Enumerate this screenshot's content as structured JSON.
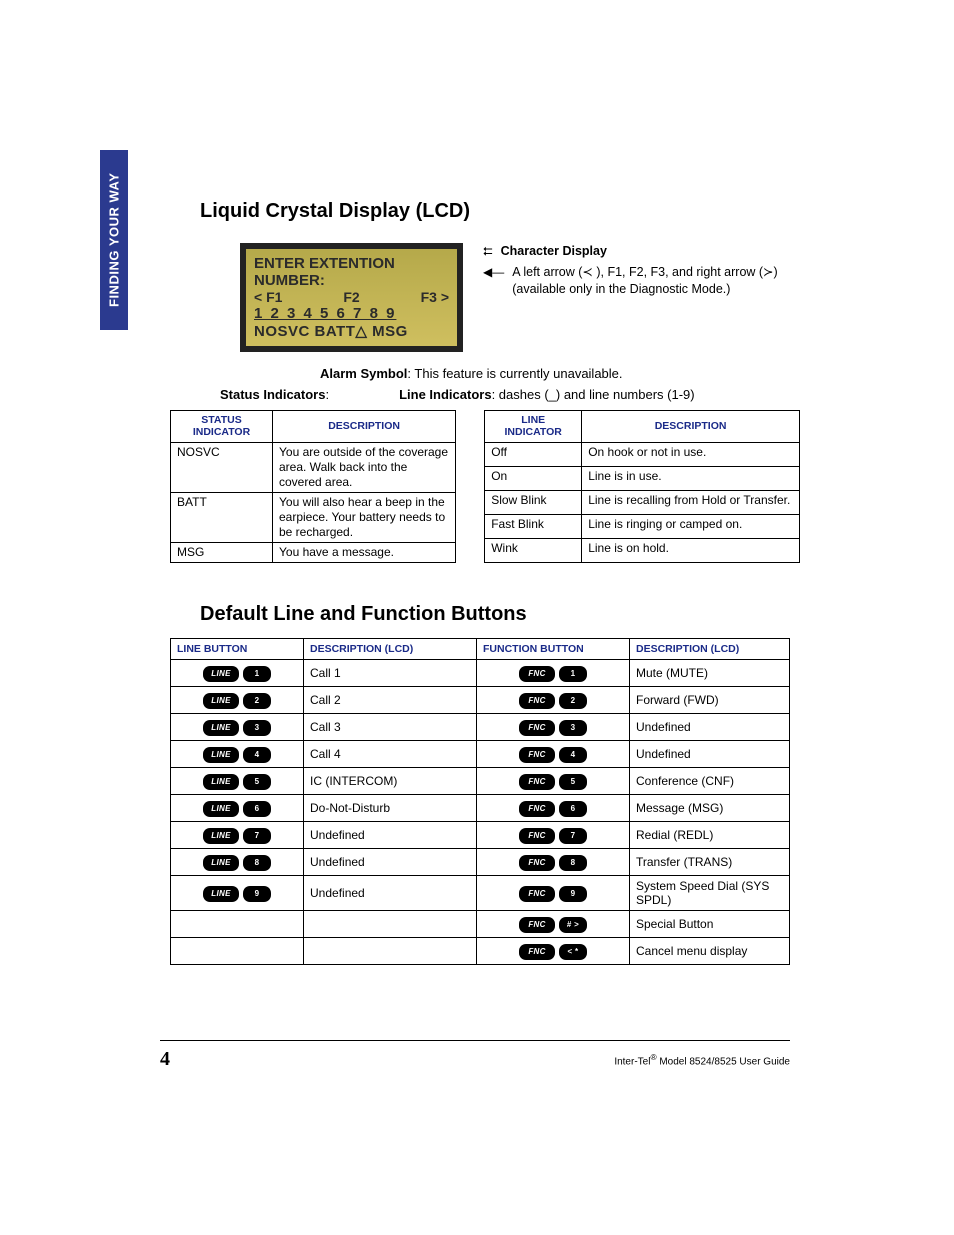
{
  "sideTab": "FINDING YOUR WAY",
  "heading1": "Liquid Crystal Display (LCD)",
  "lcd": {
    "line1": "ENTER EXTENTION",
    "line2": "NUMBER:",
    "f1": "< F1",
    "f2": "F2",
    "f3": "F3 >",
    "digits": "1 2 3 4 5 6 7 8 9",
    "status": "NOSVC BATT△  MSG"
  },
  "annot": {
    "charDisplay": "Character Display",
    "arrowLine1": "A left arrow (≺ ), F1, F2, F3, and right arrow (≻)",
    "arrowLine2": "(available only in the Diagnostic Mode.)"
  },
  "alarmLabel": "Alarm Symbol",
  "alarmText": ": This feature is currently unavailable.",
  "statusLabel": "Status Indicators",
  "lineLabel": "Line Indicators",
  "lineLabelText": ": dashes (_) and line numbers (1-9)",
  "statusTable": {
    "h1": "STATUS INDICATOR",
    "h2": "DESCRIPTION",
    "rows": [
      {
        "a": "NOSVC",
        "b": "You are outside of the coverage area. Walk back into the covered area."
      },
      {
        "a": "BATT",
        "b": "You will also hear a beep in the earpiece. Your battery needs to be recharged."
      },
      {
        "a": "MSG",
        "b": "You have a message."
      }
    ]
  },
  "lineTable": {
    "h1": "LINE INDICATOR",
    "h2": "DESCRIPTION",
    "rows": [
      {
        "a": "Off",
        "b": "On hook or not in use."
      },
      {
        "a": "On",
        "b": "Line is in use."
      },
      {
        "a": "Slow Blink",
        "b": "Line is recalling from Hold or Transfer."
      },
      {
        "a": "Fast Blink",
        "b": "Line is ringing or camped on."
      },
      {
        "a": "Wink",
        "b": "Line is on hold."
      }
    ]
  },
  "heading2": "Default Line and Function Buttons",
  "bigTable": {
    "h1": "LINE BUTTON",
    "h2": "DESCRIPTION (LCD)",
    "h3": "FUNCTION BUTTON",
    "h4": "DESCRIPTION (LCD)",
    "rows": [
      {
        "ln": "1",
        "ld": "Call 1",
        "fn": "1",
        "fd": "Mute (MUTE)"
      },
      {
        "ln": "2",
        "ld": "Call 2",
        "fn": "2",
        "fd": "Forward (FWD)"
      },
      {
        "ln": "3",
        "ld": "Call 3",
        "fn": "3",
        "fd": "Undefined"
      },
      {
        "ln": "4",
        "ld": "Call 4",
        "fn": "4",
        "fd": "Undefined"
      },
      {
        "ln": "5",
        "ld": "IC (INTERCOM)",
        "fn": "5",
        "fd": "Conference (CNF)"
      },
      {
        "ln": "6",
        "ld": "Do-Not-Disturb",
        "fn": "6",
        "fd": "Message (MSG)"
      },
      {
        "ln": "7",
        "ld": "Undefined",
        "fn": "7",
        "fd": "Redial (REDL)"
      },
      {
        "ln": "8",
        "ld": "Undefined",
        "fn": "8",
        "fd": "Transfer (TRANS)"
      },
      {
        "ln": "9",
        "ld": "Undefined",
        "fn": "9",
        "fd": "System Speed Dial (SYS SPDL)"
      },
      {
        "ln": "",
        "ld": "",
        "fn": "# >",
        "fd": "Special Button"
      },
      {
        "ln": "",
        "ld": "",
        "fn": "< *",
        "fd": "Cancel menu display"
      }
    ]
  },
  "pillLabels": {
    "line": "LINE",
    "fnc": "FNC"
  },
  "pageNumber": "4",
  "footer": {
    "brand": "Inter-Tel",
    "reg": "®",
    "rest": " Model 8524/8525 User Guide"
  }
}
